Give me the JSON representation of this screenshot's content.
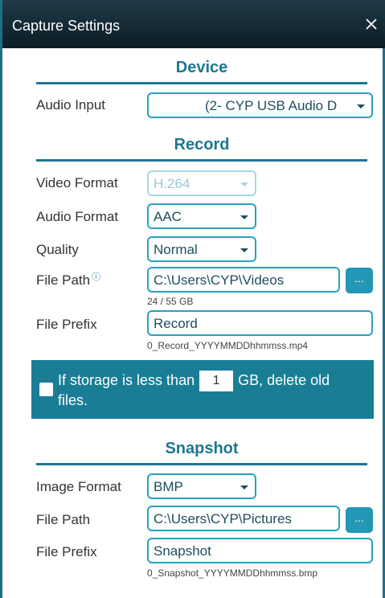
{
  "window": {
    "title": "Capture Settings"
  },
  "device": {
    "section_title": "Device",
    "audio_input_label": "Audio Input",
    "audio_input_value": "(2- CYP USB Audio D"
  },
  "record": {
    "section_title": "Record",
    "video_format_label": "Video Format",
    "video_format_value": "H.264",
    "audio_format_label": "Audio Format",
    "audio_format_value": "AAC",
    "quality_label": "Quality",
    "quality_value": "Normal",
    "file_path_label": "File Path",
    "file_path_info": "ⓘ",
    "file_path_value": "C:\\Users\\CYP\\Videos",
    "browse_label": "...",
    "storage_usage": "24 / 55 GB",
    "file_prefix_label": "File Prefix",
    "file_prefix_value": "Record",
    "file_name_example": "0_Record_YYYYMMDDhhmmss.mp4"
  },
  "storage_rule": {
    "text_before": "If storage is less than",
    "threshold": "1",
    "text_after": "GB, delete old files."
  },
  "snapshot": {
    "section_title": "Snapshot",
    "image_format_label": "Image Format",
    "image_format_value": "BMP",
    "file_path_label": "File Path",
    "file_path_value": "C:\\Users\\CYP\\Pictures",
    "browse_label": "...",
    "file_prefix_label": "File Prefix",
    "file_prefix_value": "Snapshot",
    "file_name_example": "0_Snapshot_YYYYMMDDhhmmss.bmp"
  }
}
